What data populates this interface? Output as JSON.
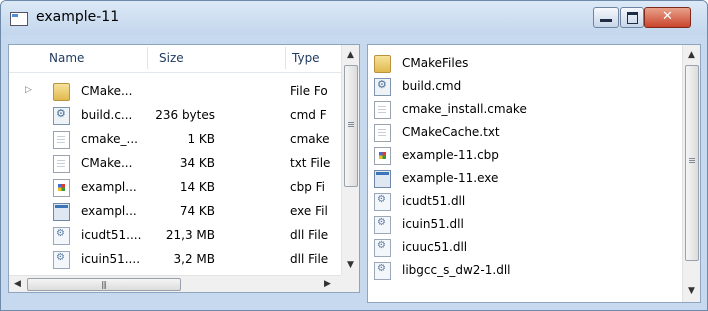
{
  "window": {
    "title": "example-11",
    "controls": {
      "minimize": "minimize",
      "maximize": "maximize",
      "close": "✕"
    }
  },
  "left_pane": {
    "columns": {
      "name": "Name",
      "size": "Size",
      "type": "Type"
    },
    "rows": [
      {
        "name": "CMake...",
        "size": "",
        "type": "File Fo",
        "icon": "folder-icon",
        "expandable": true
      },
      {
        "name": "build.c...",
        "size": "236 bytes",
        "type": "cmd F",
        "icon": "cmd-file-icon"
      },
      {
        "name": "cmake_...",
        "size": "1 KB",
        "type": "cmake",
        "icon": "file-icon"
      },
      {
        "name": "CMake...",
        "size": "34 KB",
        "type": "txt File",
        "icon": "file-icon"
      },
      {
        "name": "exampl...",
        "size": "14 KB",
        "type": "cbp Fi",
        "icon": "cbp-file-icon"
      },
      {
        "name": "exampl...",
        "size": "74 KB",
        "type": "exe Fil",
        "icon": "exe-file-icon"
      },
      {
        "name": "icudt51....",
        "size": "21,3 MB",
        "type": "dll File",
        "icon": "dll-file-icon"
      },
      {
        "name": "icuin51....",
        "size": "3,2 MB",
        "type": "dll File",
        "icon": "dll-file-icon"
      }
    ]
  },
  "right_pane": {
    "items": [
      {
        "name": "CMakeFiles",
        "icon": "folder-icon"
      },
      {
        "name": "build.cmd",
        "icon": "cmd-file-icon"
      },
      {
        "name": "cmake_install.cmake",
        "icon": "file-icon"
      },
      {
        "name": "CMakeCache.txt",
        "icon": "file-icon"
      },
      {
        "name": "example-11.cbp",
        "icon": "cbp-file-icon"
      },
      {
        "name": "example-11.exe",
        "icon": "exe-file-icon"
      },
      {
        "name": "icudt51.dll",
        "icon": "dll-file-icon"
      },
      {
        "name": "icuin51.dll",
        "icon": "dll-file-icon"
      },
      {
        "name": "icuuc51.dll",
        "icon": "dll-file-icon"
      },
      {
        "name": "libgcc_s_dw2-1.dll",
        "icon": "dll-file-icon"
      }
    ]
  },
  "colors": {
    "frame": "#c7d9ee",
    "border": "#8fa4bf",
    "close": "#c9442c",
    "header_text": "#1e3a5f"
  }
}
